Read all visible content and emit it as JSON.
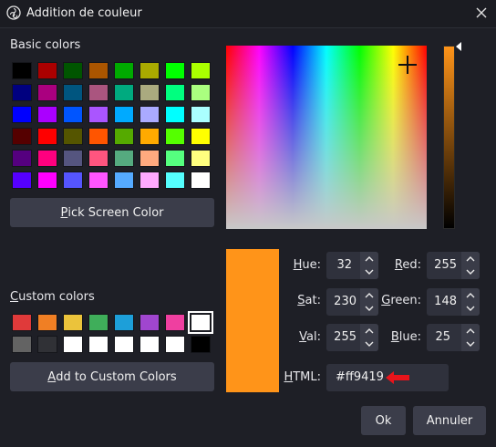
{
  "window": {
    "title": "Addition de couleur",
    "close_icon": "close-icon",
    "app_icon": "obs-logo-icon"
  },
  "basic": {
    "label": "Basic colors",
    "colors": [
      [
        "#000000",
        "#aa0000",
        "#005500",
        "#aa5500",
        "#00aa00",
        "#aaaa00",
        "#00ff00",
        "#aaff00"
      ],
      [
        "#00007f",
        "#aa007f",
        "#00557f",
        "#aa557f",
        "#00aa7f",
        "#aaaa7f",
        "#00ff7f",
        "#aaff7f"
      ],
      [
        "#0000ff",
        "#aa00ff",
        "#0055ff",
        "#aa55ff",
        "#00aaff",
        "#aaaaff",
        "#00ffff",
        "#aaffff"
      ],
      [
        "#550000",
        "#ff0000",
        "#555500",
        "#ff5500",
        "#55aa00",
        "#ffaa00",
        "#55ff00",
        "#ffff00"
      ],
      [
        "#55007f",
        "#ff007f",
        "#55557f",
        "#ff557f",
        "#55aa7f",
        "#ffaa7f",
        "#55ff7f",
        "#ffff7f"
      ],
      [
        "#5500ff",
        "#ff00ff",
        "#5555ff",
        "#ff55ff",
        "#55aaff",
        "#ffaaff",
        "#55ffff",
        "#ffffff"
      ]
    ]
  },
  "pick_screen": {
    "prefix": "",
    "accel": "P",
    "suffix": "ick Screen Color"
  },
  "custom": {
    "label_accel": "C",
    "label_rest": "ustom colors",
    "colors": [
      [
        "#e03a3a",
        "#f07f24",
        "#ebc33b",
        "#3fae5a",
        "#1d9fd9",
        "#a046cf",
        "#ef3fa0",
        "#ffffff"
      ],
      [
        "#636363",
        "#303136",
        "#ffffff",
        "#ffffff",
        "#ffffff",
        "#ffffff",
        "#ffffff",
        "#000000"
      ]
    ],
    "selected_index": 7
  },
  "add_custom": {
    "prefix": "",
    "accel": "A",
    "suffix": "dd to Custom Colors"
  },
  "current_color": "#ff9419",
  "fields": {
    "hue": {
      "accel": "H",
      "rest": "ue:",
      "value": "32"
    },
    "sat": {
      "accel": "S",
      "rest": "at:",
      "value": "230"
    },
    "val": {
      "accel": "V",
      "rest": "al:",
      "value": "255"
    },
    "red": {
      "accel": "R",
      "rest": "ed:",
      "value": "255"
    },
    "green": {
      "accel": "G",
      "rest": "reen:",
      "value": "148"
    },
    "blue": {
      "accel": "B",
      "rest": "lue:",
      "value": "25"
    },
    "html": {
      "accel": "H",
      "rest": "TML:",
      "value": "#ff9419"
    }
  },
  "buttons": {
    "ok": "Ok",
    "cancel": "Annuler"
  },
  "annotation": {
    "arrow_color": "#e8141b"
  }
}
